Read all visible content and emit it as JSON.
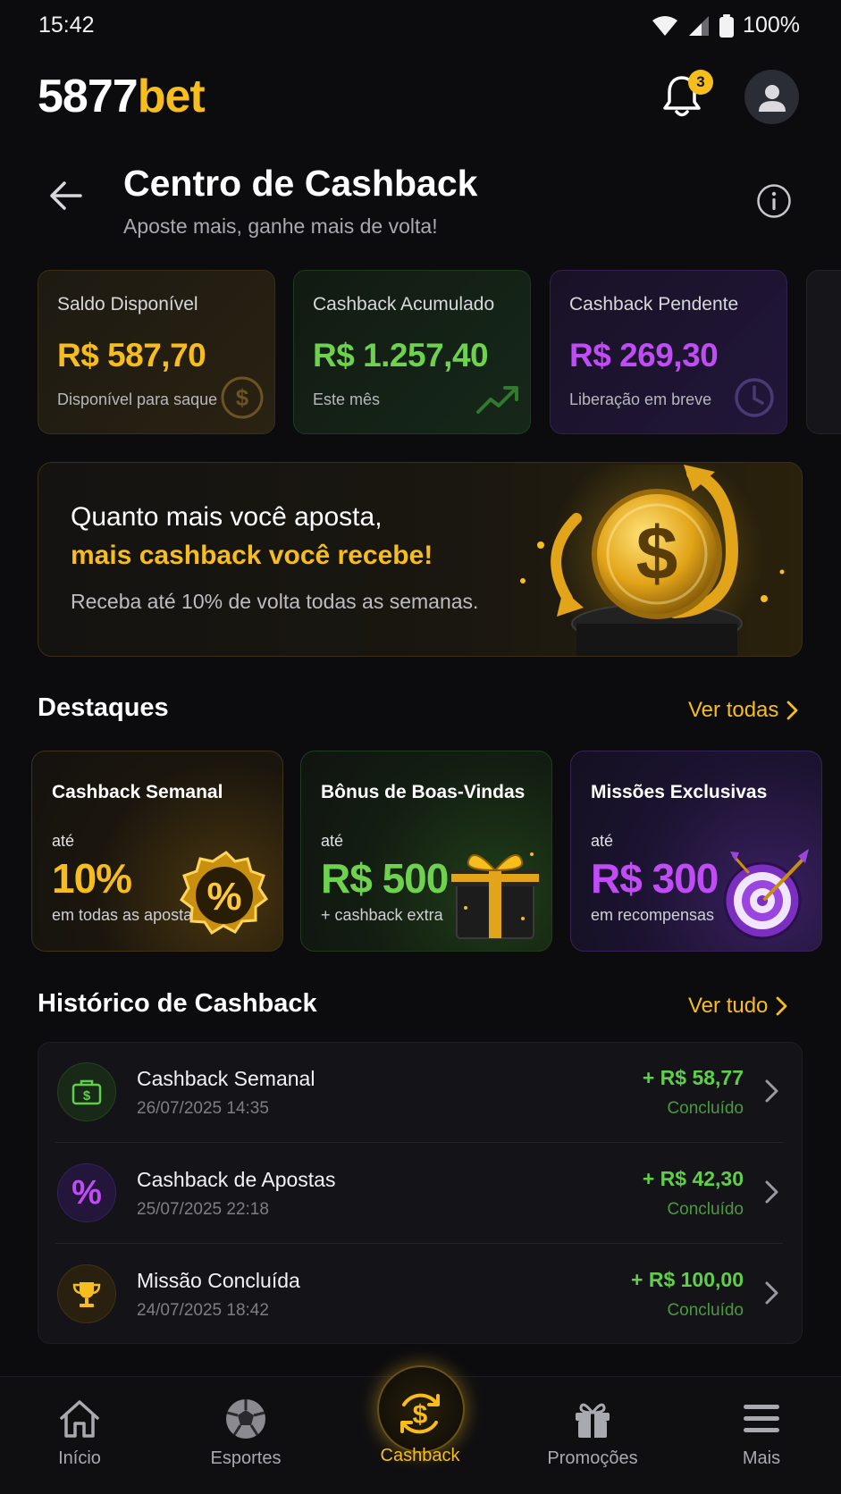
{
  "status_bar": {
    "time": "15:42",
    "battery": "100%"
  },
  "header": {
    "logo_primary": "5877",
    "logo_accent": "bet",
    "notification_count": "3"
  },
  "page": {
    "title": "Centro de Cashback",
    "subtitle": "Aposte mais, ganhe mais de volta!"
  },
  "stats": [
    {
      "label": "Saldo Disponível",
      "value": "R$ 587,70",
      "note": "Disponível para saque",
      "color": "#f6bd1c",
      "icon": "dollar-coin-icon"
    },
    {
      "label": "Cashback Acumulado",
      "value": "R$ 1.257,40",
      "note": "Este mês",
      "color": "#6fd24f",
      "icon": "trend-up-icon"
    },
    {
      "label": "Cashback Pendente",
      "value": "R$ 269,30",
      "note": "Liberação em breve",
      "color": "#c04cf5",
      "icon": "clock-icon"
    }
  ],
  "promo": {
    "line1": "Quanto mais você aposta,",
    "line2": "mais cashback você recebe!",
    "line3": "Receba até 10% de volta todas as semanas."
  },
  "highlights": {
    "title": "Destaques",
    "link": "Ver todas",
    "items": [
      {
        "title": "Cashback Semanal",
        "pre": "até",
        "value": "10%",
        "note": "em todas as apostas",
        "color": "#f6bd1c",
        "icon": "percent-badge-icon"
      },
      {
        "title": "Bônus de Boas-Vindas",
        "pre": "até",
        "value": "R$ 500",
        "note": "+ cashback extra",
        "color": "#6fd24f",
        "icon": "gift-box-icon"
      },
      {
        "title": "Missões Exclusivas",
        "pre": "até",
        "value": "R$ 300",
        "note": "em recompensas",
        "color": "#c04cf5",
        "icon": "target-icon"
      }
    ]
  },
  "history": {
    "title": "Histórico de Cashback",
    "link": "Ver tudo",
    "items": [
      {
        "title": "Cashback Semanal",
        "date": "26/07/2025 14:35",
        "amount": "+ R$ 58,77",
        "status": "Concluído",
        "icon": "wallet-dollar-icon"
      },
      {
        "title": "Cashback de Apostas",
        "date": "25/07/2025 22:18",
        "amount": "+ R$ 42,30",
        "status": "Concluído",
        "icon": "percent-icon"
      },
      {
        "title": "Missão Concluída",
        "date": "24/07/2025 18:42",
        "amount": "+ R$ 100,00",
        "status": "Concluído",
        "icon": "trophy-icon"
      }
    ]
  },
  "nav": [
    {
      "label": "Início",
      "icon": "home-icon"
    },
    {
      "label": "Esportes",
      "icon": "soccer-ball-icon"
    },
    {
      "label": "Cashback",
      "icon": "cashback-icon",
      "active": true
    },
    {
      "label": "Promoções",
      "icon": "gift-icon"
    },
    {
      "label": "Mais",
      "icon": "menu-icon"
    }
  ],
  "colors": {
    "accent": "#f6bd1c",
    "green": "#6fd24f",
    "purple": "#c04cf5",
    "background": "#0c0c0f"
  }
}
